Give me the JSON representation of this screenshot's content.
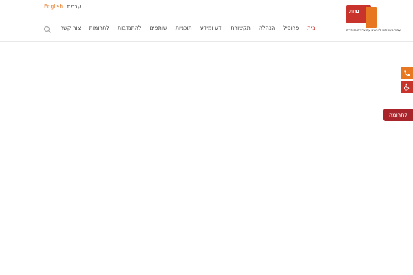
{
  "language_switch": {
    "english": "English",
    "separator": "|",
    "hebrew": "עברית"
  },
  "logo": {
    "mark": "נחת",
    "tagline": "עבור משפחות לאנשים עם צרכים מיוחדים"
  },
  "nav": {
    "items": [
      {
        "label": "בית",
        "active": true
      },
      {
        "label": "פרופיל"
      },
      {
        "label": "הנהלה"
      },
      {
        "label": "תקשורת"
      },
      {
        "label": "ידע ומידע"
      },
      {
        "label": "תוכניות"
      },
      {
        "label": "שותפים"
      },
      {
        "label": "להתנדבות"
      },
      {
        "label": "לתרומות"
      },
      {
        "label": "צור קשר"
      }
    ]
  },
  "icons": {
    "search": "search-icon",
    "phone": "phone-icon",
    "accessibility": "accessibility-icon"
  },
  "donate_button": {
    "label": "לתרומה"
  },
  "colors": {
    "accent": "#e87722",
    "brand": "#c8332c",
    "donate": "#a8262b"
  }
}
